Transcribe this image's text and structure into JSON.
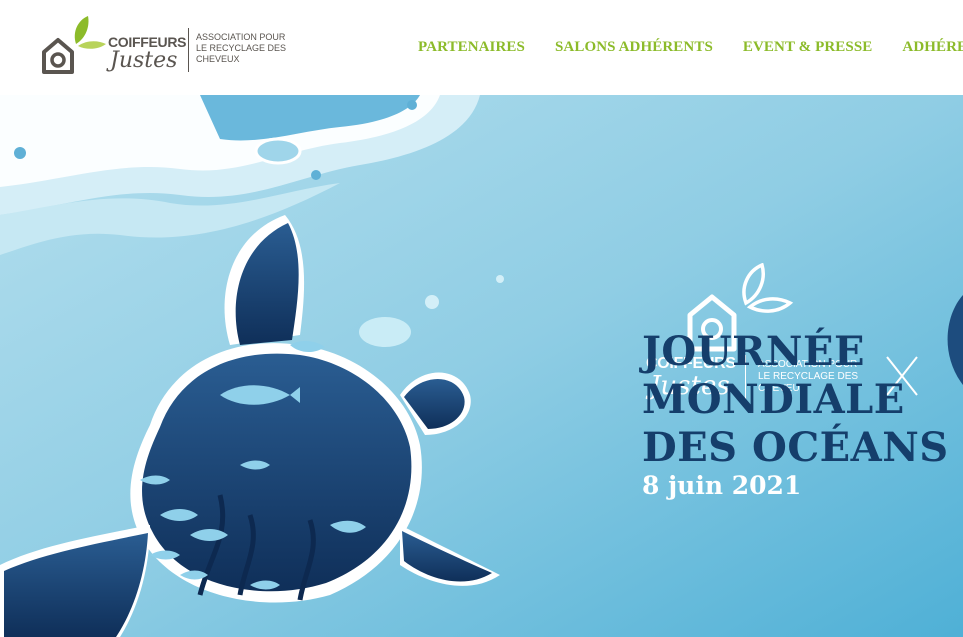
{
  "header": {
    "logo": {
      "wordmark": "COIFFEURS",
      "script": "Justes",
      "tagline": "ASSOCIATION POUR LE RECYCLAGE DES CHEVEUX"
    },
    "nav": [
      {
        "label": "PARTENAIRES"
      },
      {
        "label": "SALONS ADHÉRENTS"
      },
      {
        "label": "EVENT & PRESSE"
      },
      {
        "label": "ADHÉRER"
      }
    ]
  },
  "hero": {
    "logo": {
      "wordmark": "COIFFEURS",
      "script": "Justes",
      "tagline": "ASSOCIATION POUR LE RECYCLAGE DES CHEVEUX"
    },
    "title_lines": [
      "JOURNÉE",
      "MONDIALE",
      "DES OCÉANS"
    ],
    "date": "8 juin 2021"
  },
  "colors": {
    "nav_green": "#8cbb2a",
    "logo_grey": "#5a5550",
    "ocean_light": "#a9d9ea",
    "ocean_mid": "#6fbcd9",
    "ocean_dark": "#153e6b",
    "title_navy": "#153e6b"
  }
}
